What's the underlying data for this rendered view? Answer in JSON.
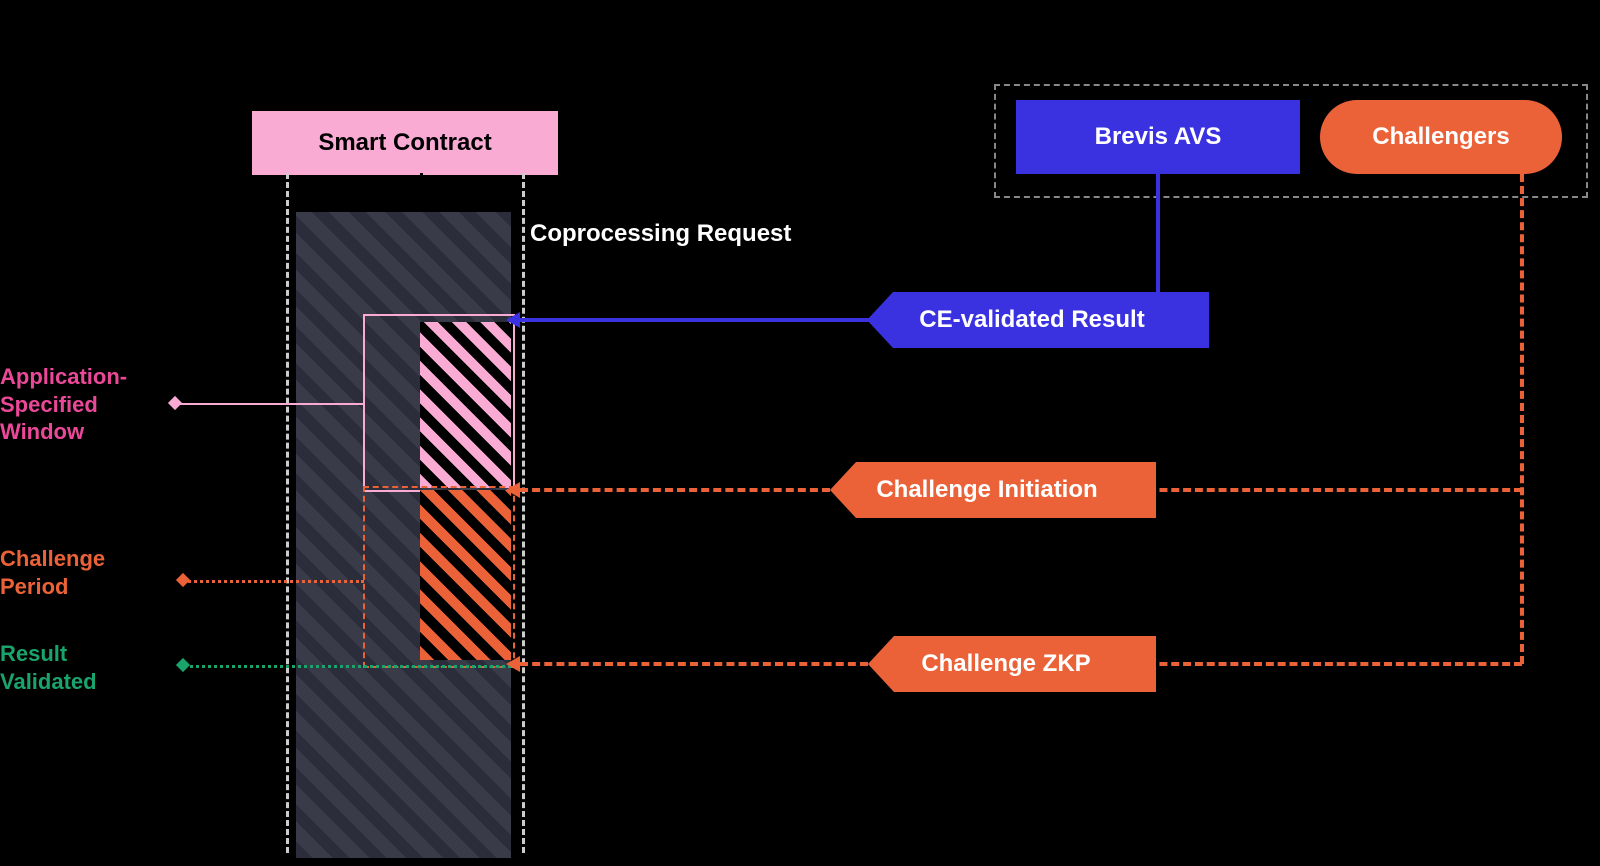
{
  "diagram": {
    "smart_contract": "Smart Contract",
    "coprocessing_label": "Coprocessing Request",
    "actors": {
      "brevis": "Brevis AVS",
      "challengers": "Challengers"
    },
    "tags": {
      "ce_validated": "CE-validated Result",
      "challenge_init": "Challenge Initiation",
      "challenge_zkp": "Challenge ZKP"
    },
    "left_labels": {
      "app_window": "Application-\nSpecified\nWindow",
      "challenge_period": "Challenge\nPeriod",
      "result_validated": "Result\nValidated"
    },
    "colors": {
      "pink": "#f9abd4",
      "magenta_text": "#ec4899",
      "orange": "#eb6238",
      "green": "#1aa36b",
      "blue": "#3a32e0",
      "dark": "#2c2d3a"
    }
  }
}
